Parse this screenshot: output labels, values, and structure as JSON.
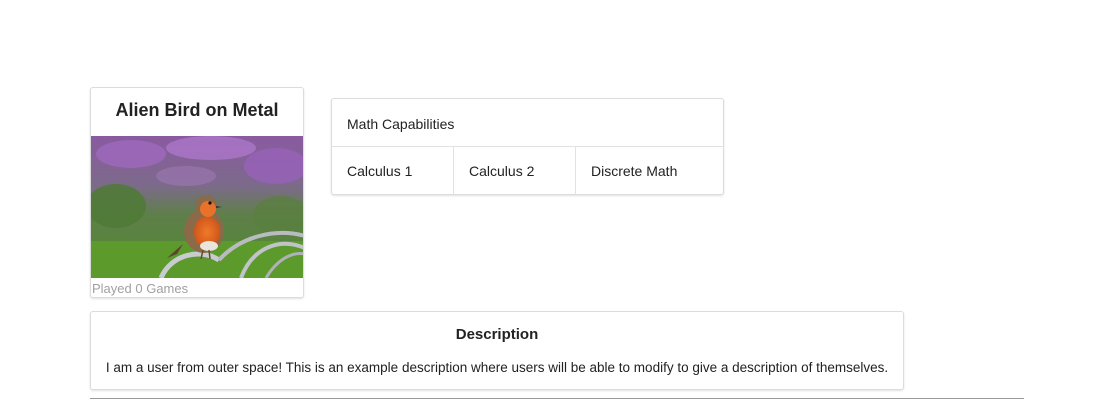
{
  "profile": {
    "name": "Alien Bird on Metal",
    "photo_alt": "Robin perched on metal railing",
    "games_played": "Played 0 Games"
  },
  "math": {
    "title": "Math Capabilities",
    "items": [
      {
        "label": "Calculus 1"
      },
      {
        "label": "Calculus 2"
      },
      {
        "label": "Discrete Math"
      }
    ]
  },
  "description": {
    "title": "Description",
    "text": "I am a user from outer space! This is an example description where users will be able to modify to give a description of themselves."
  }
}
